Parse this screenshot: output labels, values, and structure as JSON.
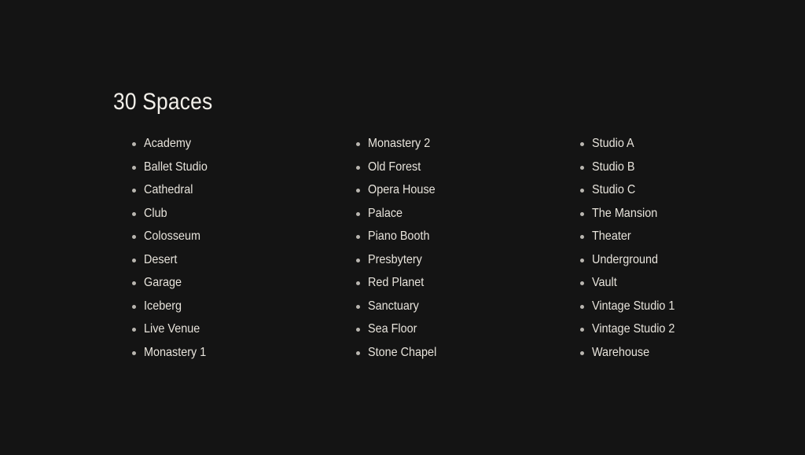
{
  "page": {
    "title": "30 Spaces",
    "background_color": "#141414",
    "text_color": "#e8e4dc",
    "title_color": "#f2efe9",
    "bullet_color": "#b9b6b0",
    "bullet_icon": "bullet-dot-icon",
    "total_count": 30
  },
  "columns": [
    {
      "items": [
        {
          "label": "Academy"
        },
        {
          "label": "Ballet Studio"
        },
        {
          "label": "Cathedral"
        },
        {
          "label": "Club"
        },
        {
          "label": "Colosseum"
        },
        {
          "label": "Desert"
        },
        {
          "label": "Garage"
        },
        {
          "label": "Iceberg"
        },
        {
          "label": "Live Venue"
        },
        {
          "label": "Monastery 1"
        }
      ]
    },
    {
      "items": [
        {
          "label": "Monastery 2"
        },
        {
          "label": "Old Forest"
        },
        {
          "label": "Opera House"
        },
        {
          "label": "Palace"
        },
        {
          "label": "Piano Booth"
        },
        {
          "label": "Presbytery"
        },
        {
          "label": "Red Planet"
        },
        {
          "label": "Sanctuary"
        },
        {
          "label": "Sea Floor"
        },
        {
          "label": "Stone Chapel"
        }
      ]
    },
    {
      "items": [
        {
          "label": "Studio A"
        },
        {
          "label": "Studio B"
        },
        {
          "label": "Studio C"
        },
        {
          "label": "The Mansion"
        },
        {
          "label": "Theater"
        },
        {
          "label": "Underground"
        },
        {
          "label": "Vault"
        },
        {
          "label": "Vintage Studio 1"
        },
        {
          "label": "Vintage Studio 2"
        },
        {
          "label": "Warehouse"
        }
      ]
    }
  ]
}
